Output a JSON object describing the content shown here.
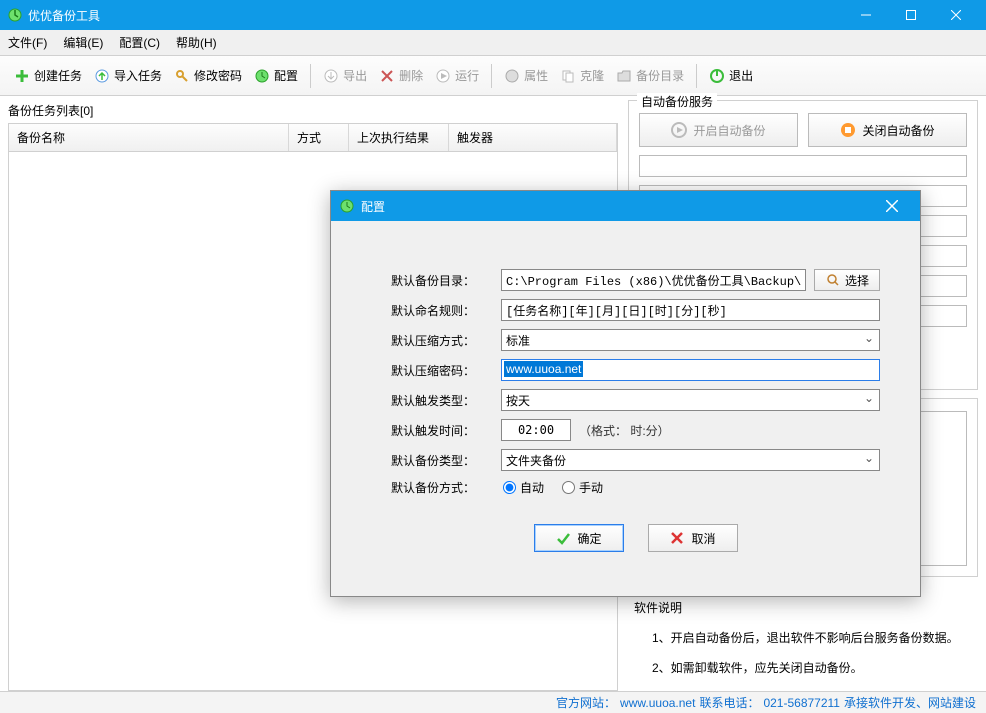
{
  "window": {
    "title": "优优备份工具"
  },
  "menu": {
    "file": "文件(F)",
    "edit": "编辑(E)",
    "config": "配置(C)",
    "help": "帮助(H)"
  },
  "toolbar": {
    "create": "创建任务",
    "import": "导入任务",
    "changepw": "修改密码",
    "config": "配置",
    "export": "导出",
    "delete": "删除",
    "run": "运行",
    "props": "属性",
    "clone": "克隆",
    "backupdir": "备份目录",
    "exit": "退出"
  },
  "left": {
    "list_label": "备份任务列表[0]",
    "cols": {
      "name": "备份名称",
      "mode": "方式",
      "lastresult": "上次执行结果",
      "trigger": "触发器"
    }
  },
  "right": {
    "service_title": "自动备份服务",
    "start_btn": "开启自动备份",
    "stop_btn": "关闭自动备份",
    "desc_title": "软件说明",
    "desc1": "1、开启自动备份后，退出软件不影响后台服务备份数据。",
    "desc2": "2、如需卸载软件，应先关闭自动备份。"
  },
  "status": {
    "site_label": "官方网站：",
    "site": "www.uuoa.net",
    "phone_label": " 联系电话：",
    "phone": "021-56877211",
    "tail": " 承接软件开发、网站建设"
  },
  "dialog": {
    "title": "配置",
    "labels": {
      "backupdir": "默认备份目录：",
      "naming": "默认命名规则：",
      "compress": "默认压缩方式：",
      "password": "默认压缩密码：",
      "triggertype": "默认触发类型：",
      "triggertime": "默认触发时间：",
      "backuptype": "默认备份类型：",
      "backupmode": "默认备份方式："
    },
    "values": {
      "backupdir": "C:\\Program Files (x86)\\优优备份工具\\Backup\\",
      "naming": "[任务名称][年][月][日][时][分][秒]",
      "compress": "标准",
      "password": "www.uuoa.net",
      "triggertype": "按天",
      "triggertime": "02:00",
      "triggertime_hint": "（格式：  时:分）",
      "backuptype": "文件夹备份",
      "mode_auto": "自动",
      "mode_manual": "手动"
    },
    "browse": "选择",
    "ok": "确定",
    "cancel": "取消"
  }
}
